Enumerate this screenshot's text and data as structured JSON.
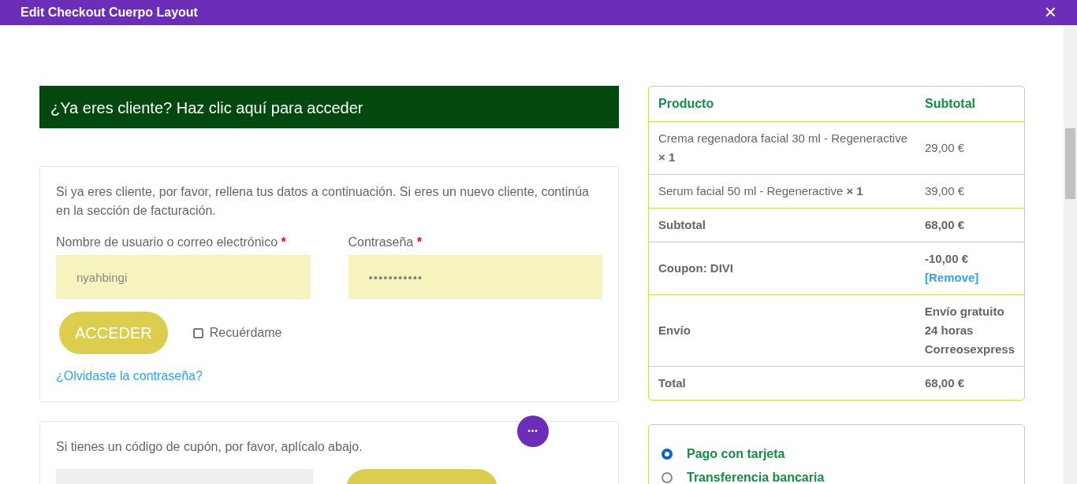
{
  "window": {
    "title": "Edit Checkout Cuerpo Layout",
    "close": "×"
  },
  "login_notice": "¿Ya eres cliente? Haz clic aquí para acceder",
  "login_form": {
    "intro": "Si ya eres cliente, por favor, rellena tus datos a continuación. Si eres un nuevo cliente, continúa en la sección de facturación.",
    "fields": [
      {
        "label": "Nombre de usuario o correo electrónico",
        "required_mark": "*",
        "value": "nyahbingi",
        "kind": "text"
      },
      {
        "label": "Contraseña",
        "required_mark": "*",
        "value": "•••••••••••",
        "kind": "password"
      }
    ],
    "submit": "ACCEDER",
    "remember": {
      "label": "Recuérdame",
      "checked": false
    },
    "lost_password": "¿Olvidaste la contraseña?"
  },
  "coupon_form": {
    "intro": "Si tienes un código de cupón, por favor, aplícalo abajo."
  },
  "fab": "•••",
  "order_table": {
    "columns": [
      "Producto",
      "Subtotal"
    ],
    "rows": [
      {
        "kind": "item",
        "label": "Crema regenadora facial 30 ml - Regeneractive  **× 1**",
        "value_lines": [
          "29,00 €"
        ]
      },
      {
        "kind": "item",
        "label": "Serum facial 50 ml - Regeneractive  **× 1**",
        "value_lines": [
          "39,00 €"
        ]
      },
      {
        "kind": "total",
        "label": "Subtotal",
        "value_lines": [
          "68,00 €"
        ]
      },
      {
        "kind": "total",
        "label": "Coupon: DIVI",
        "value_lines": [
          "-10,00 €"
        ],
        "link": "[Remove]"
      },
      {
        "kind": "total",
        "label": "Envío",
        "value_lines": [
          "Envío gratuito",
          "24 horas",
          "Correosexpress"
        ]
      },
      {
        "kind": "total",
        "label": "Total",
        "value_lines": [
          "68,00 €"
        ]
      }
    ]
  },
  "payment_methods": [
    {
      "label": "Pago con tarjeta",
      "selected": true
    },
    {
      "label": "Transferencia bancaria",
      "selected": false
    }
  ]
}
